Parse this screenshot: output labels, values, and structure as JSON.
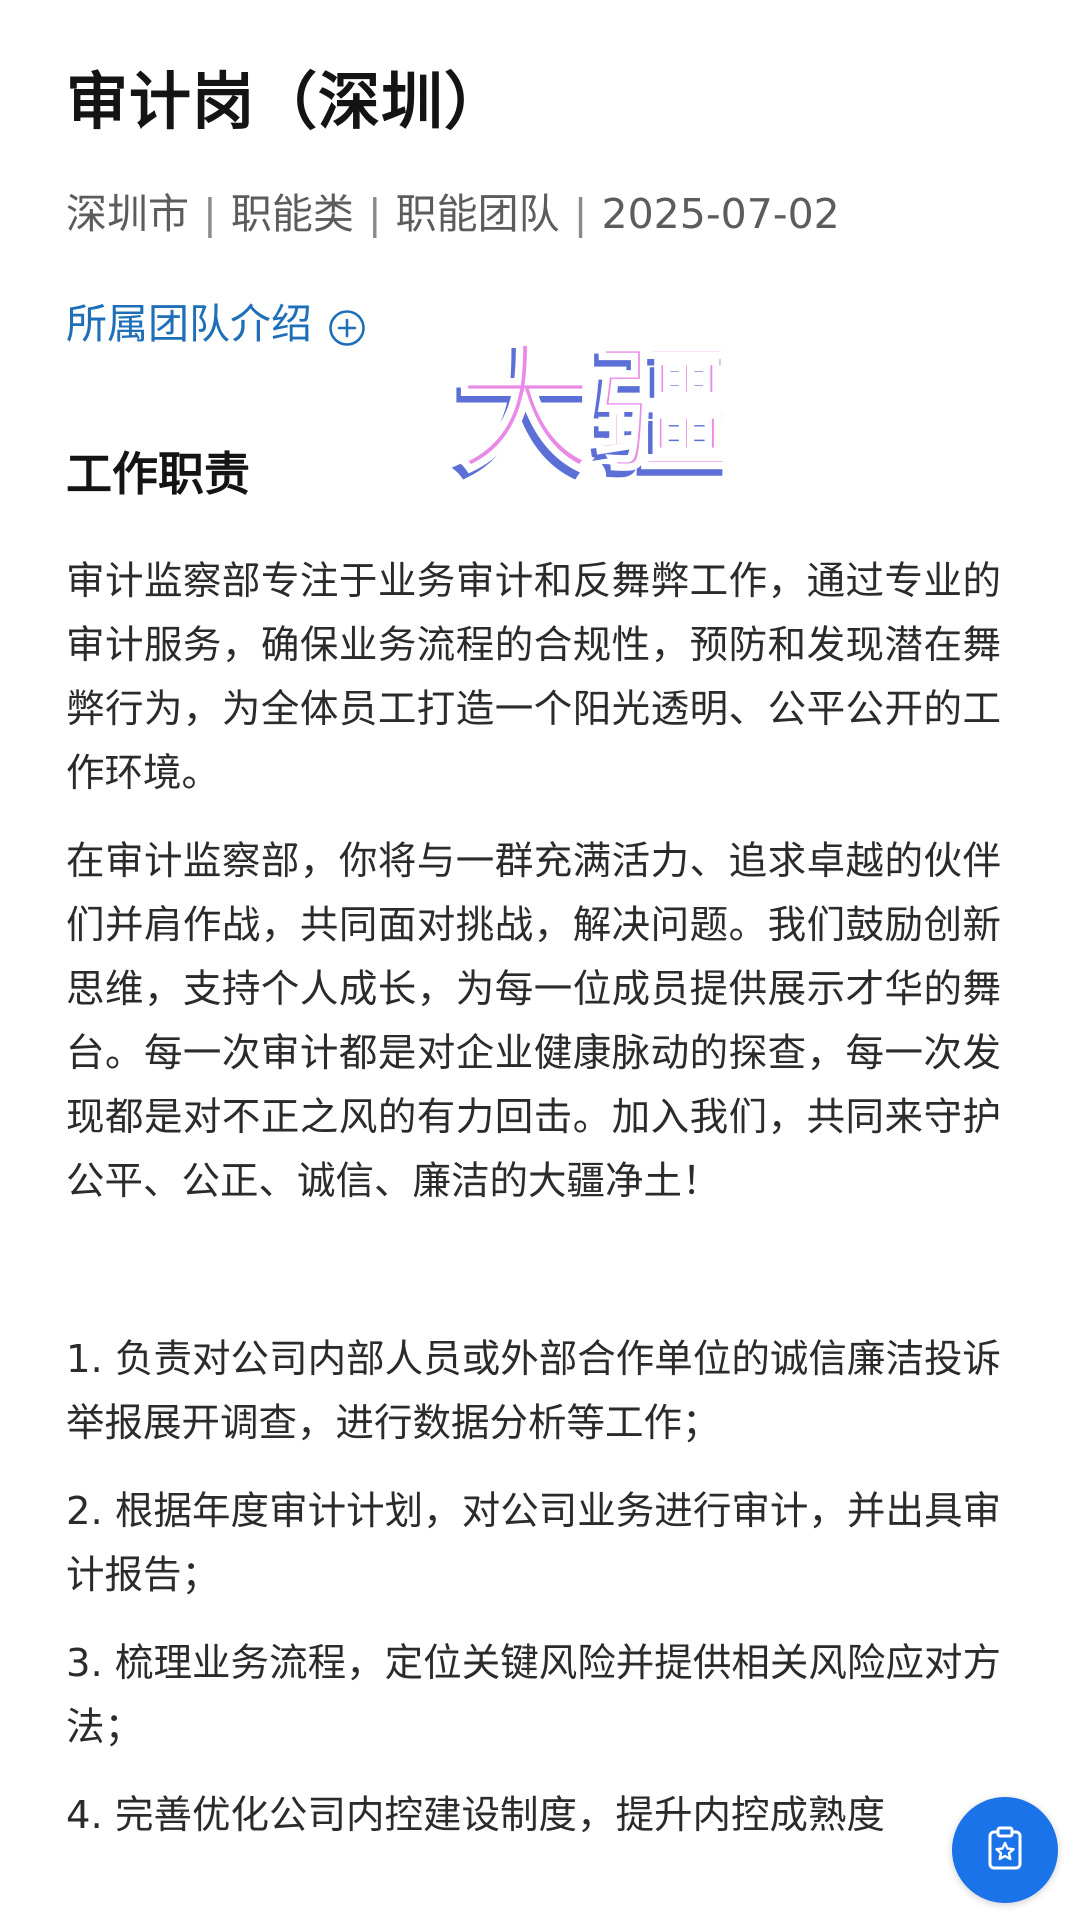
{
  "job": {
    "title": "审计岗（深圳）",
    "city": "深圳市",
    "category": "职能类",
    "team": "职能团队",
    "date": "2025-07-02",
    "separator": "|"
  },
  "team_link": {
    "label": "所属团队介绍",
    "icon": "plus-circle-icon"
  },
  "watermark": {
    "text": "大疆",
    "fill": "#e98be6",
    "shadow": "#5b6fd6"
  },
  "section": {
    "title": "工作职责"
  },
  "paragraphs": [
    "审计监察部专注于业务审计和反舞弊工作，通过专业的审计服务，确保业务流程的合规性，预防和发现潜在舞弊行为，为全体员工打造一个阳光透明、公平公开的工作环境。",
    "在审计监察部，你将与一群充满活力、追求卓越的伙伴们并肩作战，共同面对挑战，解决问题。我们鼓励创新思维，支持个人成长，为每一位成员提供展示才华的舞台。每一次审计都是对企业健康脉动的探查，每一次发现都是对不正之风的有力回击。加入我们，共同来守护公平、公正、诚信、廉洁的大疆净土！"
  ],
  "duties": [
    "1. 负责对公司内部人员或外部合作单位的诚信廉洁投诉举报展开调查，进行数据分析等工作；",
    "2. 根据年度审计计划，对公司业务进行审计，并出具审计报告；",
    "3. 梳理业务流程，定位关键风险并提供相关风险应对方法；",
    "4. 完善优化公司内控建设制度，提升内控成熟度"
  ],
  "fab": {
    "icon": "clipboard-star-icon",
    "color": "#1a73e8"
  },
  "colors": {
    "link": "#1f6fb8",
    "meta": "#5c5c5c",
    "body_text": "#2b2b2b"
  }
}
